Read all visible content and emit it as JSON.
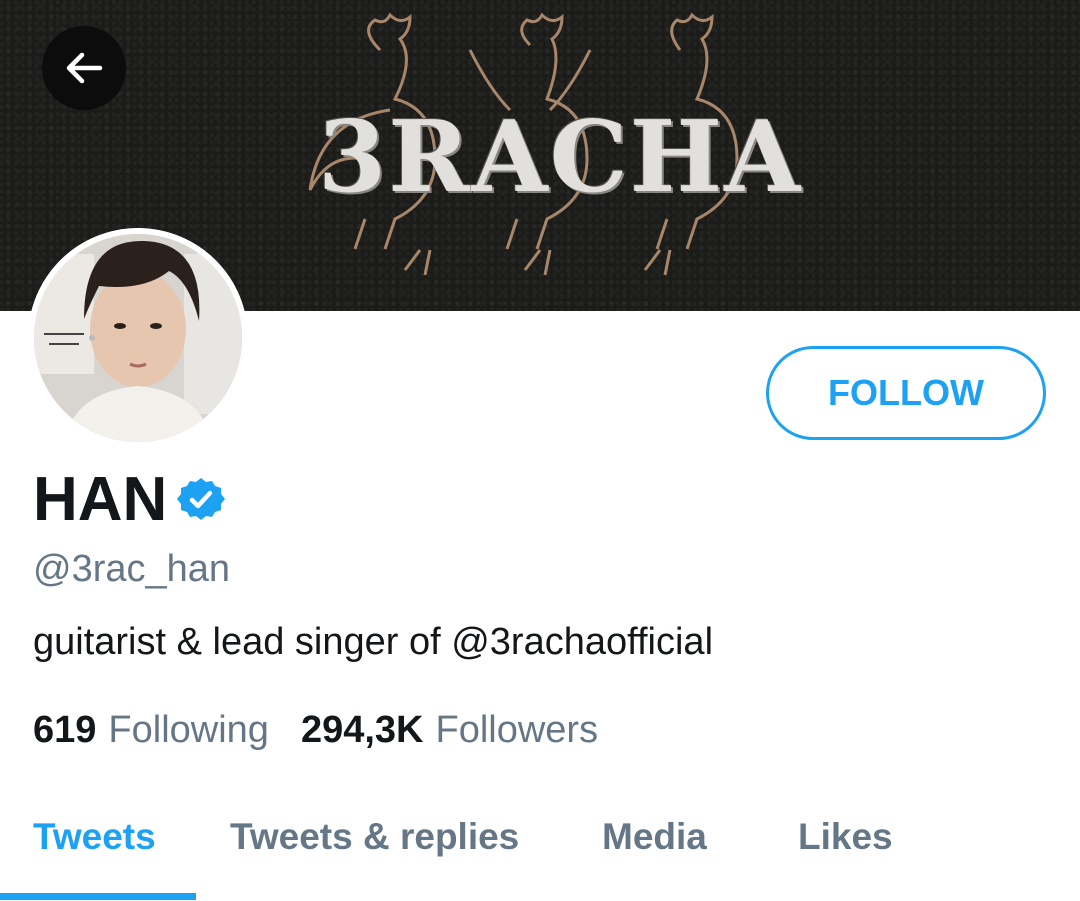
{
  "header": {
    "banner_text": "3RACHA",
    "back_icon": "arrow-left-icon"
  },
  "profile": {
    "name": "HAN",
    "verified": true,
    "verified_icon": "verified-badge-icon",
    "handle": "@3rac_han",
    "bio": "guitarist & lead singer of @3rachaofficial",
    "following_count": "619",
    "following_label": "Following",
    "followers_count": "294,3K",
    "followers_label": "Followers"
  },
  "actions": {
    "follow_label": "FOLLOW"
  },
  "tabs": [
    {
      "label": "Tweets",
      "active": true
    },
    {
      "label": "Tweets & replies",
      "active": false
    },
    {
      "label": "Media",
      "active": false
    },
    {
      "label": "Likes",
      "active": false
    }
  ],
  "colors": {
    "accent": "#1da1f2",
    "secondary_text": "#657786",
    "primary_text": "#14171a",
    "banner_bg": "#1b1b19"
  }
}
